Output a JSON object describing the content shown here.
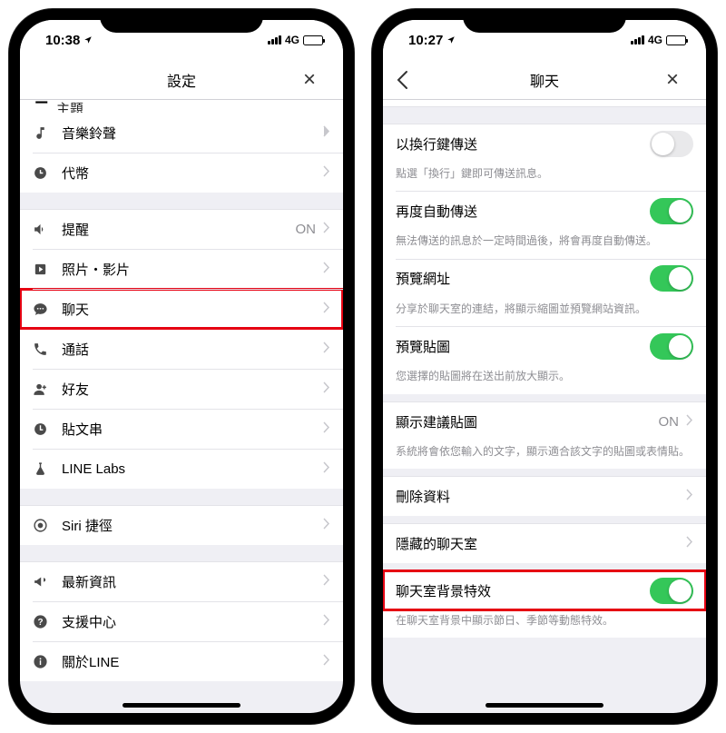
{
  "phone1": {
    "status": {
      "time": "10:38",
      "network": "4G"
    },
    "nav": {
      "title": "設定"
    },
    "partial_top_label": "主題",
    "rows_g1": [
      {
        "key": "music",
        "label": "音樂鈴聲"
      },
      {
        "key": "coin",
        "label": "代幣"
      }
    ],
    "rows_g2": [
      {
        "key": "notify",
        "label": "提醒",
        "tail": "ON"
      },
      {
        "key": "photo",
        "label": "照片・影片"
      },
      {
        "key": "chat",
        "label": "聊天",
        "highlight": true
      },
      {
        "key": "call",
        "label": "通話"
      },
      {
        "key": "friends",
        "label": "好友"
      },
      {
        "key": "timeline",
        "label": "貼文串"
      },
      {
        "key": "labs",
        "label": "LINE Labs"
      }
    ],
    "rows_g3": [
      {
        "key": "siri",
        "label": "Siri 捷徑"
      }
    ],
    "rows_g4": [
      {
        "key": "news",
        "label": "最新資訊"
      },
      {
        "key": "help",
        "label": "支援中心"
      },
      {
        "key": "about",
        "label": "關於LINE"
      }
    ]
  },
  "phone2": {
    "status": {
      "time": "10:27",
      "network": "4G"
    },
    "nav": {
      "title": "聊天"
    },
    "items": [
      {
        "type": "row_toggle",
        "label": "以換行鍵傳送",
        "on": false
      },
      {
        "type": "desc",
        "text": "點選「換行」鍵即可傳送訊息。"
      },
      {
        "type": "row_toggle",
        "label": "再度自動傳送",
        "on": true
      },
      {
        "type": "desc",
        "text": "無法傳送的訊息於一定時間過後，將會再度自動傳送。"
      },
      {
        "type": "row_toggle",
        "label": "預覽網址",
        "on": true
      },
      {
        "type": "desc",
        "text": "分享於聊天室的連結，將顯示縮圖並預覽網站資訊。"
      },
      {
        "type": "row_toggle",
        "label": "預覽貼圖",
        "on": true
      },
      {
        "type": "desc",
        "text": "您選擇的貼圖將在送出前放大顯示。"
      },
      {
        "type": "gap"
      },
      {
        "type": "row_tail",
        "label": "顯示建議貼圖",
        "tail": "ON"
      },
      {
        "type": "desc",
        "text": "系統將會依您輸入的文字，顯示適合該文字的貼圖或表情貼。"
      },
      {
        "type": "gap"
      },
      {
        "type": "row_chev",
        "label": "刪除資料"
      },
      {
        "type": "gap"
      },
      {
        "type": "row_chev",
        "label": "隱藏的聊天室"
      },
      {
        "type": "gap"
      },
      {
        "type": "row_toggle",
        "label": "聊天室背景特效",
        "on": true,
        "highlight": true
      },
      {
        "type": "desc",
        "text": "在聊天室背景中顯示節日、季節等動態特效。"
      }
    ]
  }
}
